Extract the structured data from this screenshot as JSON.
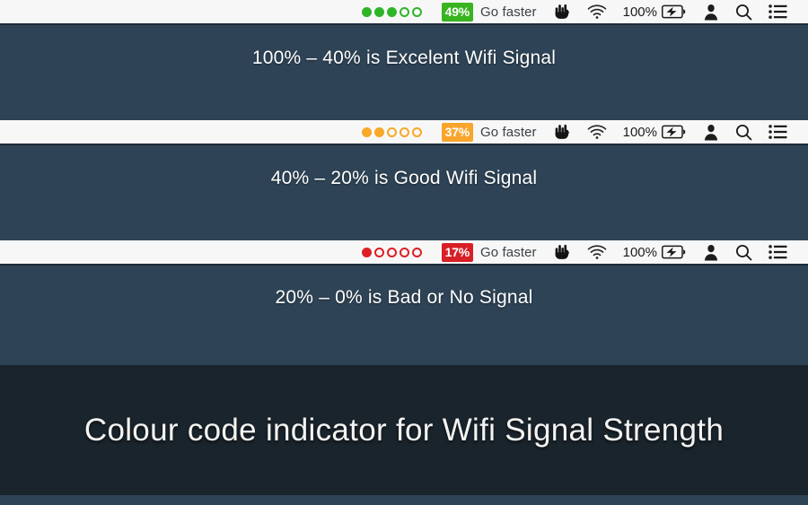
{
  "rows": [
    {
      "id": "excellent",
      "menubar": {
        "signal": {
          "dots_total": 5,
          "dots_filled": 3,
          "color": "#2fb429"
        },
        "percent_badge": {
          "label": "49%",
          "bg": "#37b41e",
          "text_color": "#ffffff"
        },
        "go_faster_label": "Go faster",
        "hand_icon": "horns-hand-icon",
        "wifi_icon": "wifi-icon",
        "battery_label": "100%",
        "battery_icon": "battery-charging-icon",
        "user_icon": "user-icon",
        "search_icon": "search-icon",
        "notifications_icon": "notification-list-icon"
      },
      "description": "100% – 40% is Excelent Wifi Signal"
    },
    {
      "id": "good",
      "menubar": {
        "signal": {
          "dots_total": 5,
          "dots_filled": 2,
          "color": "#f7a928"
        },
        "percent_badge": {
          "label": "37%",
          "bg": "#f9a52b",
          "text_color": "#ffffff"
        },
        "go_faster_label": "Go faster",
        "hand_icon": "horns-hand-icon",
        "wifi_icon": "wifi-icon",
        "battery_label": "100%",
        "battery_icon": "battery-charging-icon",
        "user_icon": "user-icon",
        "search_icon": "search-icon",
        "notifications_icon": "notification-list-icon"
      },
      "description": "40% – 20% is Good Wifi Signal"
    },
    {
      "id": "bad",
      "menubar": {
        "signal": {
          "dots_total": 5,
          "dots_filled": 1,
          "color": "#de1f26"
        },
        "percent_badge": {
          "label": "17%",
          "bg": "#d81f26",
          "text_color": "#ffffff"
        },
        "go_faster_label": "Go faster",
        "hand_icon": "horns-hand-icon",
        "wifi_icon": "wifi-icon",
        "battery_label": "100%",
        "battery_icon": "battery-charging-icon",
        "user_icon": "user-icon",
        "search_icon": "search-icon",
        "notifications_icon": "notification-list-icon"
      },
      "description": "20% – 0% is Bad or No Signal"
    }
  ],
  "caption": "Colour code indicator for Wifi Signal Strength",
  "colors": {
    "menubar_bg": "#f7f7f7",
    "content_bg": "#2e4456",
    "caption_bg": "#1a242c",
    "excellent": "#37b41e",
    "good": "#f9a52b",
    "bad": "#d81f26"
  }
}
